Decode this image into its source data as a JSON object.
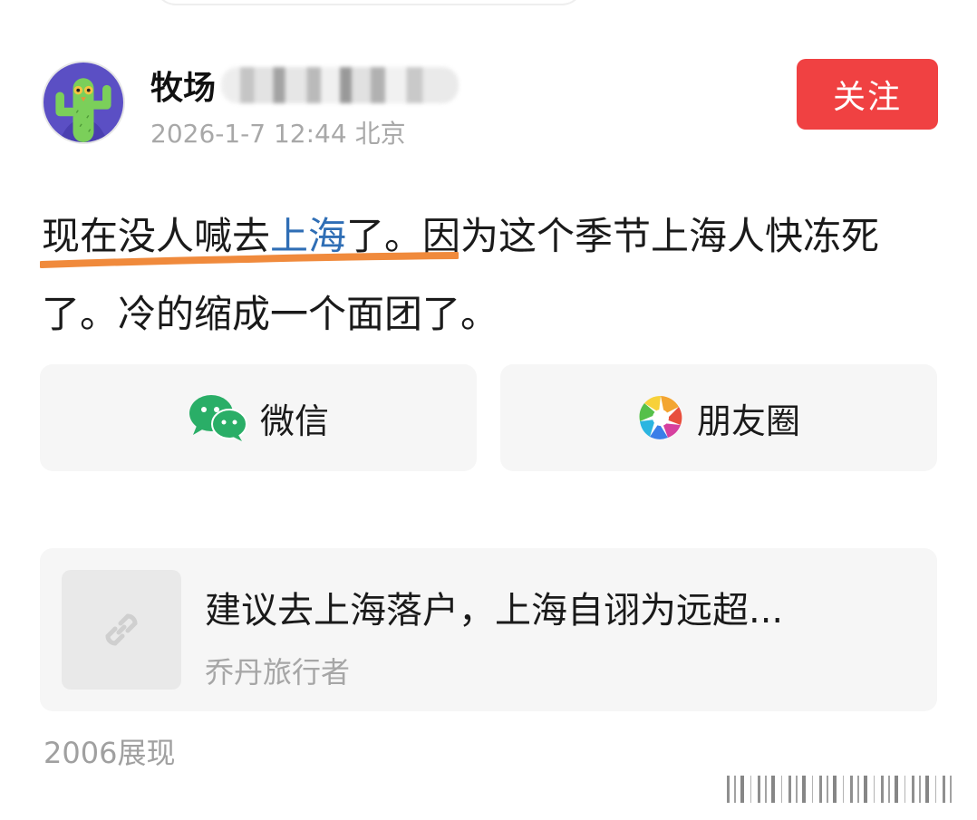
{
  "author": {
    "name": "牧场",
    "date_location": "2026-1-7 12:44 北京"
  },
  "follow_button": {
    "label": "关注"
  },
  "post": {
    "text_before": "现在没人喊去",
    "text_highlight": "上海",
    "text_after": "了。因为这个季节上海人快冻死了。冷的缩成一个面团了。"
  },
  "share": {
    "wechat_label": "微信",
    "moments_label": "朋友圈"
  },
  "link_card": {
    "title": "建议去上海落户，上海自诩为远超...",
    "source": "乔丹旅行者"
  },
  "stats": {
    "views": "2006展现"
  },
  "colors": {
    "follow_bg": "#f04142",
    "highlight_text": "#2f6eb5",
    "underline": "#f08a3c",
    "avatar_bg": "#5b4fc4",
    "cactus": "#7bcf5a"
  },
  "icons": {
    "avatar": "cactus-avatar-icon",
    "wechat": "wechat-icon",
    "moments": "moments-icon",
    "link": "link-icon"
  }
}
